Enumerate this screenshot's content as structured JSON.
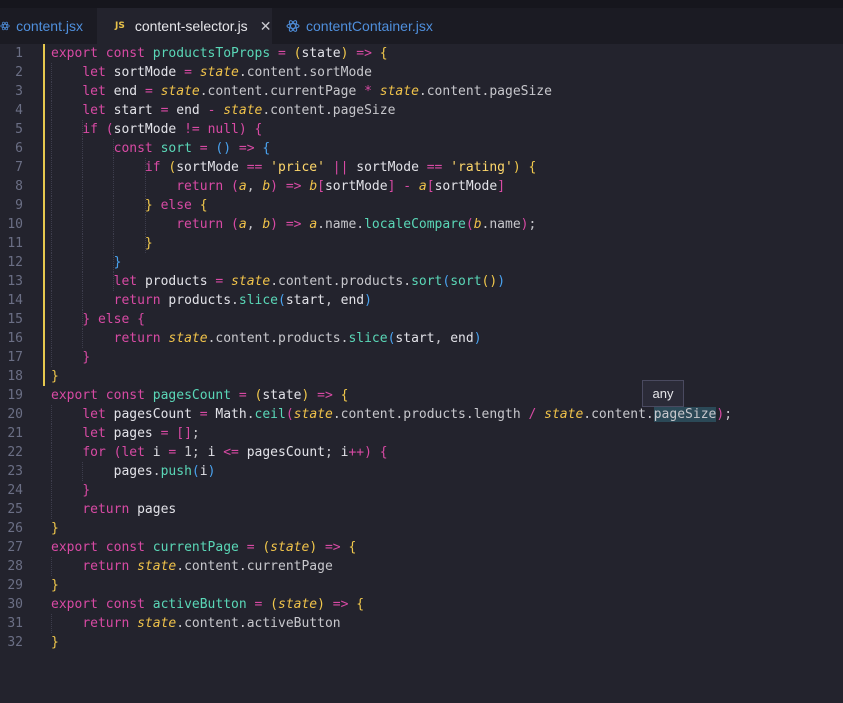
{
  "tabs": [
    {
      "label": "content.jsx",
      "icon": "react-icon"
    },
    {
      "label": "content-selector.js",
      "icon": "js-icon",
      "active": true,
      "close": "✕"
    },
    {
      "label": "contentContainer.jsx",
      "icon": "react-icon"
    }
  ],
  "js_badge": "JS",
  "tooltip": "any",
  "lines": [
    {
      "n": "1"
    },
    {
      "n": "2"
    },
    {
      "n": "3"
    },
    {
      "n": "4"
    },
    {
      "n": "5"
    },
    {
      "n": "6"
    },
    {
      "n": "7"
    },
    {
      "n": "8"
    },
    {
      "n": "9"
    },
    {
      "n": "10"
    },
    {
      "n": "11"
    },
    {
      "n": "12"
    },
    {
      "n": "13"
    },
    {
      "n": "14"
    },
    {
      "n": "15"
    },
    {
      "n": "16"
    },
    {
      "n": "17"
    },
    {
      "n": "18"
    },
    {
      "n": "19"
    },
    {
      "n": "20"
    },
    {
      "n": "21"
    },
    {
      "n": "22"
    },
    {
      "n": "23"
    },
    {
      "n": "24"
    },
    {
      "n": "25"
    },
    {
      "n": "26"
    },
    {
      "n": "27"
    },
    {
      "n": "28"
    },
    {
      "n": "29"
    },
    {
      "n": "30"
    },
    {
      "n": "31"
    },
    {
      "n": "32"
    }
  ],
  "code": [
    [
      [
        "kw",
        "export"
      ],
      [
        "p",
        " "
      ],
      [
        "kw",
        "const"
      ],
      [
        "p",
        " "
      ],
      [
        "fn",
        "productsToProps"
      ],
      [
        "p",
        " "
      ],
      [
        "op",
        "="
      ],
      [
        "p",
        " "
      ],
      [
        "br",
        "("
      ],
      [
        "cn",
        "state"
      ],
      [
        "br",
        ")"
      ],
      [
        "p",
        " "
      ],
      [
        "op",
        "=>"
      ],
      [
        "p",
        " "
      ],
      [
        "br",
        "{"
      ]
    ],
    [
      [
        "p",
        "    "
      ],
      [
        "kw",
        "let"
      ],
      [
        "p",
        " "
      ],
      [
        "cn",
        "sortMode"
      ],
      [
        "p",
        " "
      ],
      [
        "op",
        "="
      ],
      [
        "p",
        " "
      ],
      [
        "it",
        "state"
      ],
      [
        "p",
        ".content.sortMode"
      ]
    ],
    [
      [
        "p",
        "    "
      ],
      [
        "kw",
        "let"
      ],
      [
        "p",
        " "
      ],
      [
        "cn",
        "end"
      ],
      [
        "p",
        " "
      ],
      [
        "op",
        "="
      ],
      [
        "p",
        " "
      ],
      [
        "it",
        "state"
      ],
      [
        "p",
        ".content.currentPage "
      ],
      [
        "op",
        "*"
      ],
      [
        "p",
        " "
      ],
      [
        "it",
        "state"
      ],
      [
        "p",
        ".content.pageSize"
      ]
    ],
    [
      [
        "p",
        "    "
      ],
      [
        "kw",
        "let"
      ],
      [
        "p",
        " "
      ],
      [
        "cn",
        "start"
      ],
      [
        "p",
        " "
      ],
      [
        "op",
        "="
      ],
      [
        "p",
        " "
      ],
      [
        "cn",
        "end"
      ],
      [
        "p",
        " "
      ],
      [
        "op",
        "-"
      ],
      [
        "p",
        " "
      ],
      [
        "it",
        "state"
      ],
      [
        "p",
        ".content.pageSize"
      ]
    ],
    [
      [
        "p",
        "    "
      ],
      [
        "kw",
        "if"
      ],
      [
        "p",
        " "
      ],
      [
        "br2",
        "("
      ],
      [
        "cn",
        "sortMode"
      ],
      [
        "p",
        " "
      ],
      [
        "op",
        "!="
      ],
      [
        "p",
        " "
      ],
      [
        "kw",
        "null"
      ],
      [
        "br2",
        ")"
      ],
      [
        "p",
        " "
      ],
      [
        "br2",
        "{"
      ]
    ],
    [
      [
        "p",
        "        "
      ],
      [
        "kw",
        "const"
      ],
      [
        "p",
        " "
      ],
      [
        "fn",
        "sort"
      ],
      [
        "p",
        " "
      ],
      [
        "op",
        "="
      ],
      [
        "p",
        " "
      ],
      [
        "br3",
        "()"
      ],
      [
        "p",
        " "
      ],
      [
        "op",
        "=>"
      ],
      [
        "p",
        " "
      ],
      [
        "br3",
        "{"
      ]
    ],
    [
      [
        "p",
        "            "
      ],
      [
        "kw",
        "if"
      ],
      [
        "p",
        " "
      ],
      [
        "br",
        "("
      ],
      [
        "cn",
        "sortMode"
      ],
      [
        "p",
        " "
      ],
      [
        "op",
        "=="
      ],
      [
        "p",
        " "
      ],
      [
        "str",
        "'price'"
      ],
      [
        "p",
        " "
      ],
      [
        "op",
        "||"
      ],
      [
        "p",
        " "
      ],
      [
        "cn",
        "sortMode"
      ],
      [
        "p",
        " "
      ],
      [
        "op",
        "=="
      ],
      [
        "p",
        " "
      ],
      [
        "str",
        "'rating'"
      ],
      [
        "br",
        ")"
      ],
      [
        "p",
        " "
      ],
      [
        "br",
        "{"
      ]
    ],
    [
      [
        "p",
        "                "
      ],
      [
        "kw",
        "return"
      ],
      [
        "p",
        " "
      ],
      [
        "br2",
        "("
      ],
      [
        "it",
        "a"
      ],
      [
        "p",
        ", "
      ],
      [
        "it",
        "b"
      ],
      [
        "br2",
        ")"
      ],
      [
        "p",
        " "
      ],
      [
        "op",
        "=>"
      ],
      [
        "p",
        " "
      ],
      [
        "it",
        "b"
      ],
      [
        "br2",
        "["
      ],
      [
        "cn",
        "sortMode"
      ],
      [
        "br2",
        "]"
      ],
      [
        "p",
        " "
      ],
      [
        "op",
        "-"
      ],
      [
        "p",
        " "
      ],
      [
        "it",
        "a"
      ],
      [
        "br2",
        "["
      ],
      [
        "cn",
        "sortMode"
      ],
      [
        "br2",
        "]"
      ]
    ],
    [
      [
        "p",
        "            "
      ],
      [
        "br",
        "}"
      ],
      [
        "p",
        " "
      ],
      [
        "kw",
        "else"
      ],
      [
        "p",
        " "
      ],
      [
        "br",
        "{"
      ]
    ],
    [
      [
        "p",
        "                "
      ],
      [
        "kw",
        "return"
      ],
      [
        "p",
        " "
      ],
      [
        "br2",
        "("
      ],
      [
        "it",
        "a"
      ],
      [
        "p",
        ", "
      ],
      [
        "it",
        "b"
      ],
      [
        "br2",
        ")"
      ],
      [
        "p",
        " "
      ],
      [
        "op",
        "=>"
      ],
      [
        "p",
        " "
      ],
      [
        "it",
        "a"
      ],
      [
        "p",
        ".name."
      ],
      [
        "fn",
        "localeCompare"
      ],
      [
        "br2",
        "("
      ],
      [
        "it",
        "b"
      ],
      [
        "p",
        ".name"
      ],
      [
        "br2",
        ")"
      ],
      [
        "p",
        ";"
      ]
    ],
    [
      [
        "p",
        "            "
      ],
      [
        "br",
        "}"
      ]
    ],
    [
      [
        "p",
        "        "
      ],
      [
        "br3",
        "}"
      ]
    ],
    [
      [
        "p",
        "        "
      ],
      [
        "kw",
        "let"
      ],
      [
        "p",
        " "
      ],
      [
        "cn",
        "products"
      ],
      [
        "p",
        " "
      ],
      [
        "op",
        "="
      ],
      [
        "p",
        " "
      ],
      [
        "it",
        "state"
      ],
      [
        "p",
        ".content.products."
      ],
      [
        "fn",
        "sort"
      ],
      [
        "br3",
        "("
      ],
      [
        "fn",
        "sort"
      ],
      [
        "br",
        "()"
      ],
      [
        "br3",
        ")"
      ]
    ],
    [
      [
        "p",
        "        "
      ],
      [
        "kw",
        "return"
      ],
      [
        "p",
        " "
      ],
      [
        "cn",
        "products"
      ],
      [
        "p",
        "."
      ],
      [
        "fn",
        "slice"
      ],
      [
        "br3",
        "("
      ],
      [
        "cn",
        "start"
      ],
      [
        "p",
        ", "
      ],
      [
        "cn",
        "end"
      ],
      [
        "br3",
        ")"
      ]
    ],
    [
      [
        "p",
        "    "
      ],
      [
        "br2",
        "}"
      ],
      [
        "p",
        " "
      ],
      [
        "kw",
        "else"
      ],
      [
        "p",
        " "
      ],
      [
        "br2",
        "{"
      ]
    ],
    [
      [
        "p",
        "        "
      ],
      [
        "kw",
        "return"
      ],
      [
        "p",
        " "
      ],
      [
        "it",
        "state"
      ],
      [
        "p",
        ".content.products."
      ],
      [
        "fn",
        "slice"
      ],
      [
        "br3",
        "("
      ],
      [
        "cn",
        "start"
      ],
      [
        "p",
        ", "
      ],
      [
        "cn",
        "end"
      ],
      [
        "br3",
        ")"
      ]
    ],
    [
      [
        "p",
        "    "
      ],
      [
        "br2",
        "}"
      ]
    ],
    [
      [
        "br",
        "}"
      ]
    ],
    [
      [
        "kw",
        "export"
      ],
      [
        "p",
        " "
      ],
      [
        "kw",
        "const"
      ],
      [
        "p",
        " "
      ],
      [
        "fn",
        "pagesCount"
      ],
      [
        "p",
        " "
      ],
      [
        "op",
        "="
      ],
      [
        "p",
        " "
      ],
      [
        "br",
        "("
      ],
      [
        "cn",
        "state"
      ],
      [
        "br",
        ")"
      ],
      [
        "p",
        " "
      ],
      [
        "op",
        "=>"
      ],
      [
        "p",
        " "
      ],
      [
        "br",
        "{"
      ]
    ],
    [
      [
        "p",
        "    "
      ],
      [
        "kw",
        "let"
      ],
      [
        "p",
        " "
      ],
      [
        "cn",
        "pagesCount"
      ],
      [
        "p",
        " "
      ],
      [
        "op",
        "="
      ],
      [
        "p",
        " "
      ],
      [
        "cn",
        "Math"
      ],
      [
        "p",
        "."
      ],
      [
        "fn",
        "ceil"
      ],
      [
        "br2",
        "("
      ],
      [
        "it",
        "state"
      ],
      [
        "p",
        ".content.products.length "
      ],
      [
        "op",
        "/"
      ],
      [
        "p",
        " "
      ],
      [
        "it",
        "state"
      ],
      [
        "p",
        ".content."
      ],
      [
        "hl",
        "pageSize"
      ],
      [
        "br2",
        ")"
      ],
      [
        "p",
        ";"
      ]
    ],
    [
      [
        "p",
        "    "
      ],
      [
        "kw",
        "let"
      ],
      [
        "p",
        " "
      ],
      [
        "cn",
        "pages"
      ],
      [
        "p",
        " "
      ],
      [
        "op",
        "="
      ],
      [
        "p",
        " "
      ],
      [
        "br2",
        "[]"
      ],
      [
        "p",
        ";"
      ]
    ],
    [
      [
        "p",
        "    "
      ],
      [
        "kw",
        "for"
      ],
      [
        "p",
        " "
      ],
      [
        "br2",
        "("
      ],
      [
        "kw",
        "let"
      ],
      [
        "p",
        " "
      ],
      [
        "cn",
        "i"
      ],
      [
        "p",
        " "
      ],
      [
        "op",
        "="
      ],
      [
        "p",
        " 1; "
      ],
      [
        "cn",
        "i"
      ],
      [
        "p",
        " "
      ],
      [
        "op",
        "<="
      ],
      [
        "p",
        " "
      ],
      [
        "cn",
        "pagesCount"
      ],
      [
        "p",
        "; "
      ],
      [
        "cn",
        "i"
      ],
      [
        "op",
        "++"
      ],
      [
        "br2",
        ")"
      ],
      [
        "p",
        " "
      ],
      [
        "br2",
        "{"
      ]
    ],
    [
      [
        "p",
        "        "
      ],
      [
        "cn",
        "pages"
      ],
      [
        "p",
        "."
      ],
      [
        "fn",
        "push"
      ],
      [
        "br3",
        "("
      ],
      [
        "cn",
        "i"
      ],
      [
        "br3",
        ")"
      ]
    ],
    [
      [
        "p",
        "    "
      ],
      [
        "br2",
        "}"
      ]
    ],
    [
      [
        "p",
        "    "
      ],
      [
        "kw",
        "return"
      ],
      [
        "p",
        " "
      ],
      [
        "cn",
        "pages"
      ]
    ],
    [
      [
        "br",
        "}"
      ]
    ],
    [
      [
        "kw",
        "export"
      ],
      [
        "p",
        " "
      ],
      [
        "kw",
        "const"
      ],
      [
        "p",
        " "
      ],
      [
        "fn",
        "currentPage"
      ],
      [
        "p",
        " "
      ],
      [
        "op",
        "="
      ],
      [
        "p",
        " "
      ],
      [
        "br",
        "("
      ],
      [
        "it",
        "state"
      ],
      [
        "br",
        ")"
      ],
      [
        "p",
        " "
      ],
      [
        "op",
        "=>"
      ],
      [
        "p",
        " "
      ],
      [
        "br",
        "{"
      ]
    ],
    [
      [
        "p",
        "    "
      ],
      [
        "kw",
        "return"
      ],
      [
        "p",
        " "
      ],
      [
        "it",
        "state"
      ],
      [
        "p",
        ".content.currentPage"
      ]
    ],
    [
      [
        "br",
        "}"
      ]
    ],
    [
      [
        "kw",
        "export"
      ],
      [
        "p",
        " "
      ],
      [
        "kw",
        "const"
      ],
      [
        "p",
        " "
      ],
      [
        "fn",
        "activeButton"
      ],
      [
        "p",
        " "
      ],
      [
        "op",
        "="
      ],
      [
        "p",
        " "
      ],
      [
        "br",
        "("
      ],
      [
        "it",
        "state"
      ],
      [
        "br",
        ")"
      ],
      [
        "p",
        " "
      ],
      [
        "op",
        "=>"
      ],
      [
        "p",
        " "
      ],
      [
        "br",
        "{"
      ]
    ],
    [
      [
        "p",
        "    "
      ],
      [
        "kw",
        "return"
      ],
      [
        "p",
        " "
      ],
      [
        "it",
        "state"
      ],
      [
        "p",
        ".content.activeButton"
      ]
    ],
    [
      [
        "br",
        "}"
      ]
    ]
  ]
}
